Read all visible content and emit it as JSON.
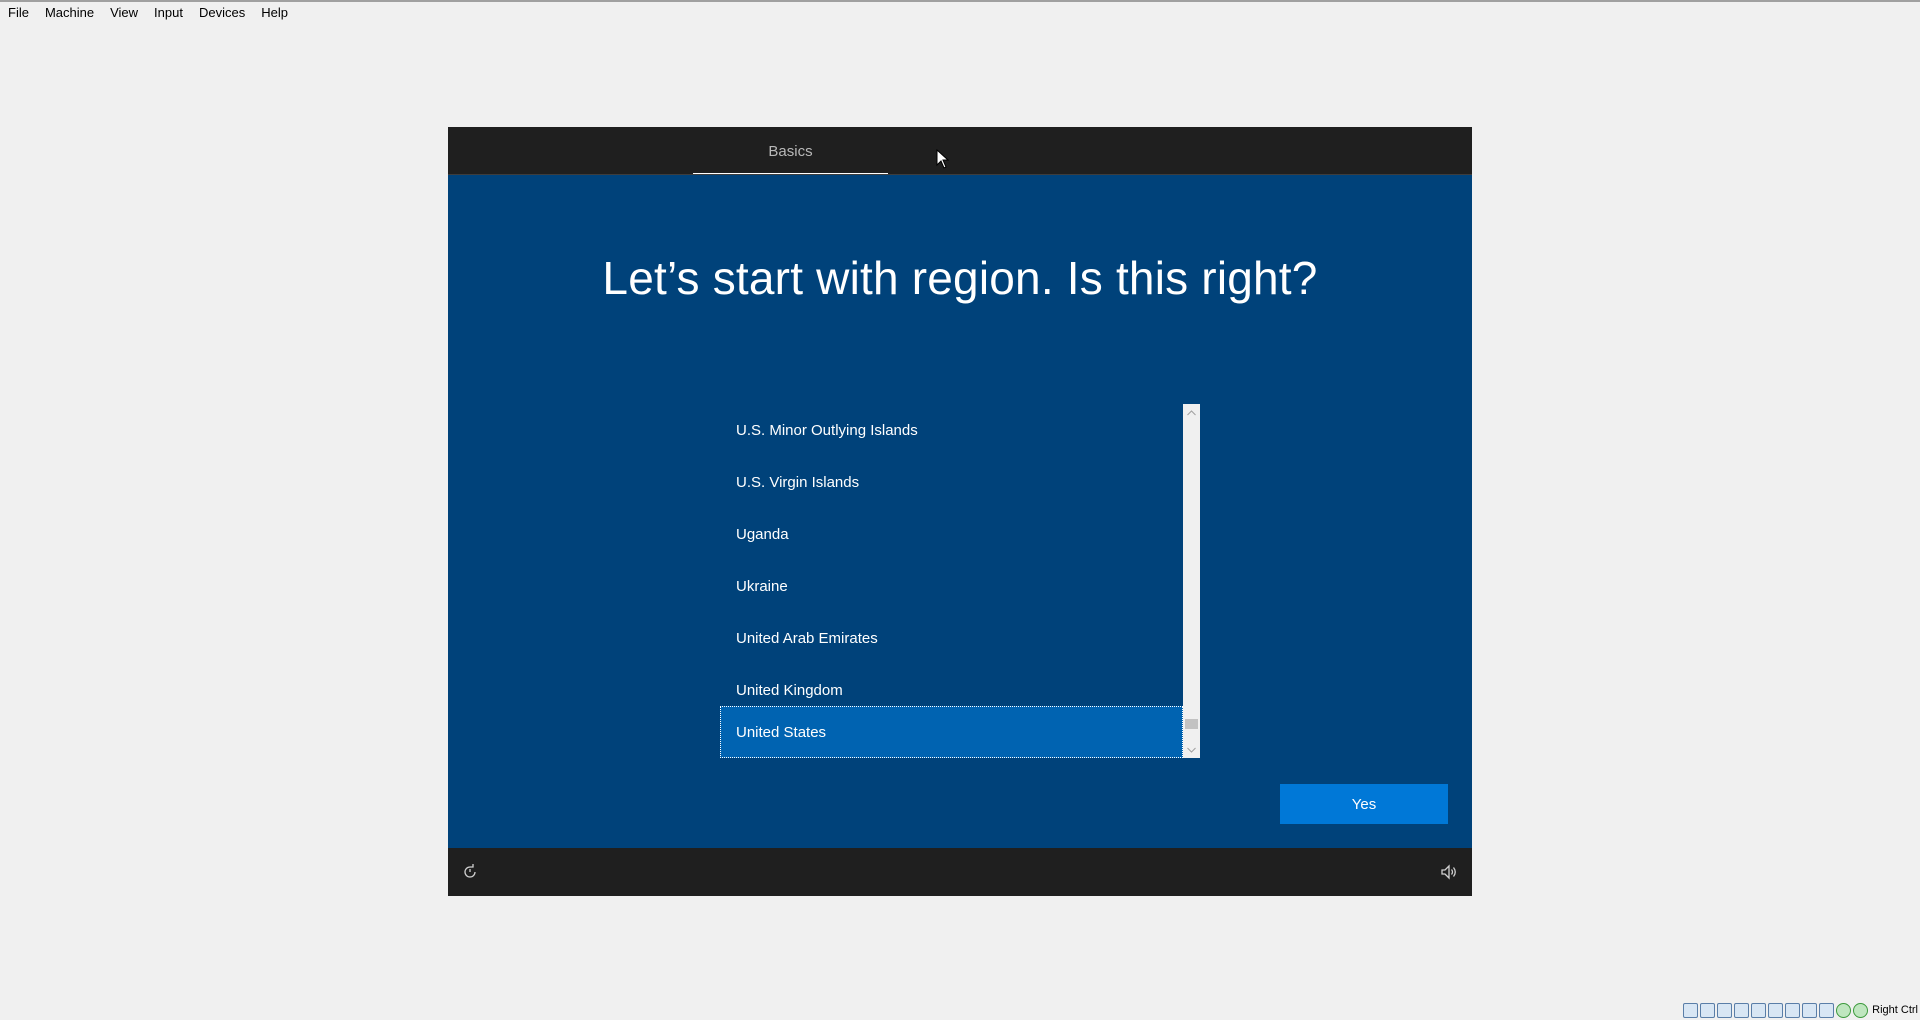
{
  "menubar": {
    "items": [
      "File",
      "Machine",
      "View",
      "Input",
      "Devices",
      "Help"
    ]
  },
  "oobe": {
    "tab_label": "Basics",
    "headline": "Let’s start with region. Is this right?",
    "regions": [
      "U.S. Minor Outlying Islands",
      "U.S. Virgin Islands",
      "Uganda",
      "Ukraine",
      "United Arab Emirates",
      "United Kingdom",
      "United States"
    ],
    "selected_region": "United States",
    "yes_label": "Yes"
  },
  "statusbar": {
    "host_key": "Right Ctrl",
    "icons": [
      "hard-disk-icon",
      "optical-drive-icon",
      "audio-icon",
      "network-icon",
      "usb-icon",
      "shared-folder-icon",
      "display-icon",
      "video-capture-icon",
      "cpu-icon",
      "mouse-integration-icon",
      "green-status-icon"
    ]
  },
  "colors": {
    "vm_background": "#00427a",
    "selected": "#0063b1",
    "button": "#0078d7",
    "dark_bar": "#1f1f1f"
  }
}
